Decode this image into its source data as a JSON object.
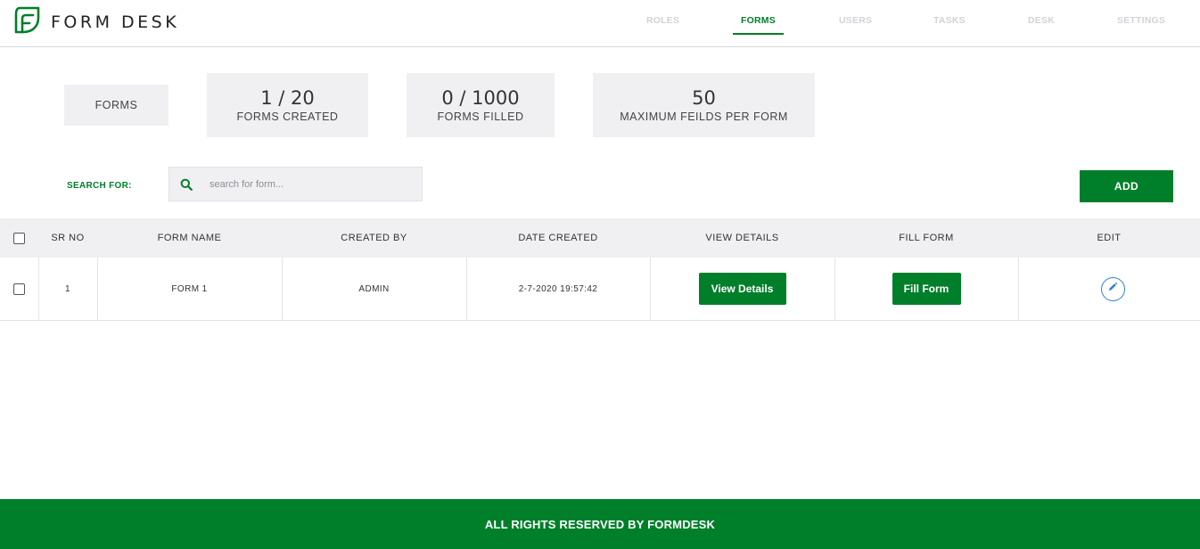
{
  "brand": {
    "name": "FORM DESK",
    "logo_icon": "formdesk-leaf-logo",
    "color": "#007f2a"
  },
  "nav": {
    "items": [
      {
        "label": "ROLES",
        "active": false
      },
      {
        "label": "FORMS",
        "active": true
      },
      {
        "label": "USERS",
        "active": false
      },
      {
        "label": "TASKS",
        "active": false
      },
      {
        "label": "DESK",
        "active": false
      },
      {
        "label": "SETTINGS",
        "active": false
      }
    ]
  },
  "stats": {
    "section_label": "FORMS",
    "forms_created": {
      "value": "1 / 20",
      "label": "FORMS CREATED"
    },
    "forms_filled": {
      "value": "0 / 1000",
      "label": "FORMS FILLED"
    },
    "max_fields": {
      "value": "50",
      "label": "MAXIMUM FEILDS PER FORM"
    }
  },
  "search": {
    "label": "SEARCH FOR:",
    "placeholder": "search for form...",
    "value": "",
    "icon": "search-icon"
  },
  "add_button": {
    "label": "ADD"
  },
  "table": {
    "headers": [
      "SR NO",
      "FORM NAME",
      "CREATED BY",
      "DATE CREATED",
      "VIEW DETAILS",
      "FILL FORM",
      "EDIT"
    ],
    "rows": [
      {
        "checked": false,
        "sr_no": "1",
        "form_name": "FORM 1",
        "created_by": "ADMIN",
        "date_created": "2-7-2020 19:57:42",
        "view_details_label": "View Details",
        "fill_form_label": "Fill Form",
        "edit_icon": "pencil-icon"
      }
    ]
  },
  "footer": {
    "text": "ALL RIGHTS RESERVED BY FORMDESK"
  },
  "colors": {
    "accent": "#007f2a",
    "panel": "#f0f0f3",
    "nav_inactive": "#d0d3d8",
    "edit_icon": "#2d7fd9"
  }
}
